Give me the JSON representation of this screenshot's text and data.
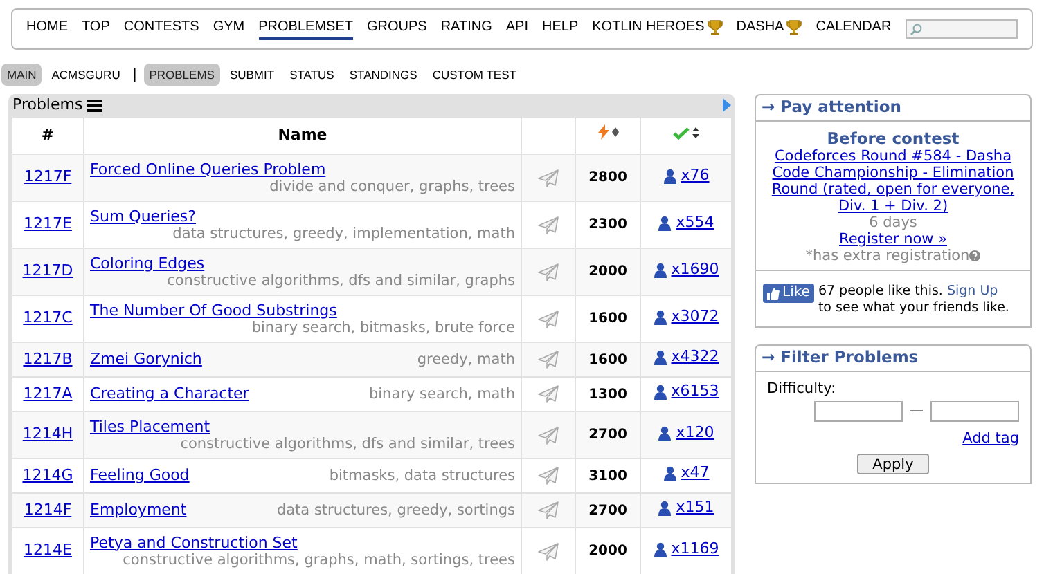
{
  "menu": [
    {
      "label": "HOME",
      "selected": false,
      "trophy": false
    },
    {
      "label": "TOP",
      "selected": false,
      "trophy": false
    },
    {
      "label": "CONTESTS",
      "selected": false,
      "trophy": false
    },
    {
      "label": "GYM",
      "selected": false,
      "trophy": false
    },
    {
      "label": "PROBLEMSET",
      "selected": true,
      "trophy": false
    },
    {
      "label": "GROUPS",
      "selected": false,
      "trophy": false
    },
    {
      "label": "RATING",
      "selected": false,
      "trophy": false
    },
    {
      "label": "API",
      "selected": false,
      "trophy": false
    },
    {
      "label": "HELP",
      "selected": false,
      "trophy": false
    },
    {
      "label": "KOTLIN HEROES",
      "selected": false,
      "trophy": true
    },
    {
      "label": "DASHA",
      "selected": false,
      "trophy": true
    },
    {
      "label": "CALENDAR",
      "selected": false,
      "trophy": false
    }
  ],
  "submenu": [
    {
      "label": "MAIN",
      "selected": true,
      "kind": "tab"
    },
    {
      "label": "ACMSGURU",
      "selected": false,
      "kind": "tab"
    },
    {
      "label": "|",
      "kind": "separator"
    },
    {
      "label": "PROBLEMS",
      "selected": true,
      "kind": "tab"
    },
    {
      "label": "SUBMIT",
      "selected": false,
      "kind": "tab"
    },
    {
      "label": "STATUS",
      "selected": false,
      "kind": "tab"
    },
    {
      "label": "STANDINGS",
      "selected": false,
      "kind": "tab"
    },
    {
      "label": "CUSTOM TEST",
      "selected": false,
      "kind": "tab"
    }
  ],
  "problems": {
    "title": "Problems",
    "columns": [
      "#",
      "Name"
    ],
    "rows": [
      {
        "id": "1217F",
        "name": "Forced Online Queries Problem",
        "tags": "divide and conquer, graphs, trees",
        "two_line": true,
        "rating": "2800",
        "solved": "x76"
      },
      {
        "id": "1217E",
        "name": "Sum Queries?",
        "tags": "data structures, greedy, implementation, math",
        "two_line": true,
        "rating": "2300",
        "solved": "x554"
      },
      {
        "id": "1217D",
        "name": "Coloring Edges",
        "tags": "constructive algorithms, dfs and similar, graphs",
        "two_line": true,
        "rating": "2000",
        "solved": "x1690"
      },
      {
        "id": "1217C",
        "name": "The Number Of Good Substrings",
        "tags": "binary search, bitmasks, brute force",
        "two_line": true,
        "rating": "1600",
        "solved": "x3072"
      },
      {
        "id": "1217B",
        "name": "Zmei Gorynich",
        "tags": "greedy, math",
        "two_line": false,
        "rating": "1600",
        "solved": "x4322"
      },
      {
        "id": "1217A",
        "name": "Creating a Character",
        "tags": "binary search, math",
        "two_line": false,
        "rating": "1300",
        "solved": "x6153"
      },
      {
        "id": "1214H",
        "name": "Tiles Placement",
        "tags": "constructive algorithms, dfs and similar, trees",
        "two_line": true,
        "rating": "2700",
        "solved": "x120"
      },
      {
        "id": "1214G",
        "name": "Feeling Good",
        "tags": "bitmasks, data structures",
        "two_line": false,
        "rating": "3100",
        "solved": "x47"
      },
      {
        "id": "1214F",
        "name": "Employment",
        "tags": "data structures, greedy, sortings",
        "two_line": false,
        "rating": "2700",
        "solved": "x151"
      },
      {
        "id": "1214E",
        "name": "Petya and Construction Set",
        "tags": "constructive algorithms, graphs, math, sortings, trees",
        "two_line": true,
        "rating": "2000",
        "solved": "x1169"
      }
    ]
  },
  "pay_attention": {
    "title": "→ Pay attention",
    "heading": "Before contest",
    "contest_link": "Codeforces Round #584 - Dasha Code Championship - Elimination Round (rated, open for everyone, Div. 1 + Div. 2)",
    "countdown": "6 days",
    "register": "Register now »",
    "note": "*has extra registration",
    "like_button": "Like",
    "like_text": "67 people like this.",
    "sign_up": "Sign Up",
    "like_text_2": "to see what your friends like."
  },
  "filter": {
    "title": "→ Filter Problems",
    "difficulty_label": "Difficulty:",
    "dash": "—",
    "add_tag": "Add tag",
    "apply": "Apply"
  }
}
